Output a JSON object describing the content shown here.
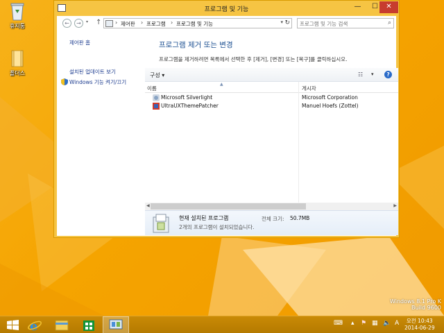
{
  "desktop": {
    "icons": [
      {
        "name": "recycle-bin",
        "label": "휴지통"
      },
      {
        "name": "folder",
        "label": "폴더스"
      }
    ],
    "watermark": {
      "line1": "Windows 8.1 Pro K",
      "line2": "Build 9600"
    }
  },
  "window": {
    "title": "프로그램 및 기능",
    "controls": {
      "minimize": "—",
      "maximize": "☐",
      "close": "✕"
    },
    "breadcrumbs": [
      "제어판",
      "프로그램",
      "프로그램 및 기능"
    ],
    "search_placeholder": "프로그램 및 기능 검색",
    "sidebar": {
      "home": "제어판 홈",
      "updates": "설치된 업데이트 보기",
      "features": "Windows 기능 켜기/끄기"
    },
    "heading": "프로그램 제거 또는 변경",
    "description": "프로그램을 제거하려면 목록에서 선택한 후 [제거], [변경] 또는 [복구]를 클릭하십시오.",
    "toolbar": {
      "organize": "구성"
    },
    "columns": {
      "name": "이름",
      "publisher": "게시자"
    },
    "programs": [
      {
        "name": "Microsoft Silverlight",
        "publisher": "Microsoft Corporation"
      },
      {
        "name": "UltraUXThemePatcher",
        "publisher": "Manuel Hoefs (Zottel)"
      }
    ],
    "details": {
      "title": "현재 설치된 프로그램",
      "size_label": "전체 크기:",
      "size_value": "50.7MB",
      "count": "2개의 프로그램이 설치되었습니다."
    }
  },
  "taskbar": {
    "items": [
      "start",
      "internet-explorer",
      "file-explorer",
      "store",
      "control-panel"
    ],
    "time": "오전 10:43",
    "date": "2014-06-29",
    "tray_lang": "A"
  },
  "colors": {
    "accent": "#f6c443",
    "link": "#1a3a8e",
    "heading": "#1b4f91",
    "close": "#c73c2e"
  }
}
